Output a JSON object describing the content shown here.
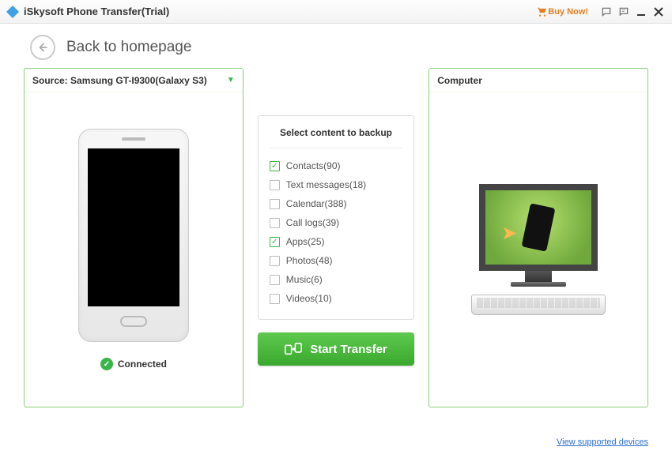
{
  "titlebar": {
    "app_title": "iSkysoft Phone Transfer(Trial)",
    "buy_label": "Buy Now!"
  },
  "header": {
    "back_label": "Back to homepage"
  },
  "source": {
    "label": "Source: Samsung GT-I9300(Galaxy S3)",
    "status": "Connected"
  },
  "destination": {
    "label": "Computer"
  },
  "backup": {
    "title": "Select content to backup",
    "items": [
      {
        "label": "Contacts(90)",
        "checked": true
      },
      {
        "label": "Text messages(18)",
        "checked": false
      },
      {
        "label": "Calendar(388)",
        "checked": false
      },
      {
        "label": "Call logs(39)",
        "checked": false
      },
      {
        "label": "Apps(25)",
        "checked": true
      },
      {
        "label": "Photos(48)",
        "checked": false
      },
      {
        "label": "Music(6)",
        "checked": false
      },
      {
        "label": "Videos(10)",
        "checked": false
      }
    ]
  },
  "actions": {
    "start_transfer": "Start Transfer"
  },
  "footer": {
    "supported_link": "View supported devices"
  }
}
